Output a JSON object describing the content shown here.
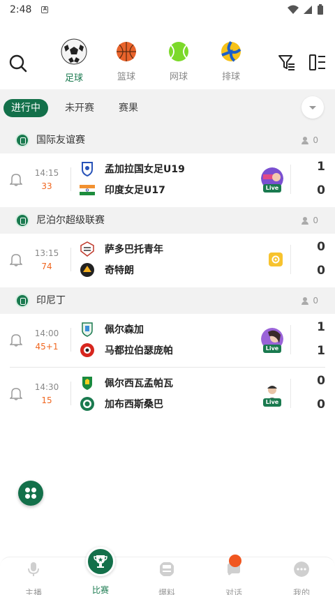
{
  "status_bar": {
    "time": "2:48",
    "app_icon": "A"
  },
  "sports": [
    {
      "label": "足球",
      "icon": "soccer-ball-icon",
      "active": true
    },
    {
      "label": "篮球",
      "icon": "basketball-icon",
      "active": false
    },
    {
      "label": "网球",
      "icon": "tennis-ball-icon",
      "active": false
    },
    {
      "label": "排球",
      "icon": "volleyball-icon",
      "active": false
    }
  ],
  "status_tabs": [
    {
      "label": "进行中",
      "active": true
    },
    {
      "label": "未开赛",
      "active": false
    },
    {
      "label": "赛果",
      "active": false
    }
  ],
  "leagues": [
    {
      "name": "国际友谊赛",
      "count": "0",
      "matches": [
        {
          "time": "14:15",
          "minute": "33",
          "home": "孟加拉国女足U19",
          "away": "印度女足U17",
          "home_score": "1",
          "away_score": "0",
          "live": true,
          "live_label": "Live"
        }
      ]
    },
    {
      "name": "尼泊尔超级联赛",
      "count": "0",
      "matches": [
        {
          "time": "13:15",
          "minute": "74",
          "home": "萨多巴托青年",
          "away": "奇特朗",
          "home_score": "0",
          "away_score": "0",
          "live": false
        }
      ]
    },
    {
      "name": "印尼丁",
      "count": "0",
      "matches": [
        {
          "time": "14:00",
          "minute": "45+1",
          "home": "佩尔森加",
          "away": "马都拉伯瑟庞帕",
          "home_score": "1",
          "away_score": "1",
          "live": true,
          "live_label": "Live"
        },
        {
          "time": "14:30",
          "minute": "15",
          "home": "佩尔西瓦孟帕瓦",
          "away": "加布西斯桑巴",
          "home_score": "0",
          "away_score": "0",
          "live": true,
          "live_label": "Live"
        }
      ]
    }
  ],
  "bottom_nav": [
    {
      "label": "主播",
      "active": false
    },
    {
      "label": "比赛",
      "active": true
    },
    {
      "label": "爆料",
      "active": false
    },
    {
      "label": "对话",
      "active": false
    },
    {
      "label": "我的",
      "active": false
    }
  ],
  "colors": {
    "accent": "#13704a",
    "minute": "#f0661f",
    "notif": "#f0561f"
  }
}
